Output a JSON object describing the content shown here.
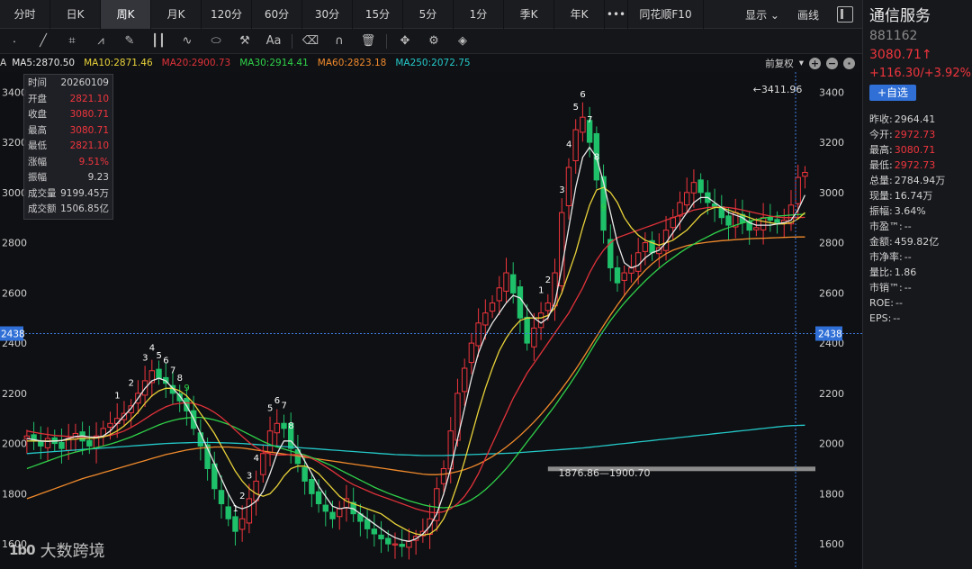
{
  "tabs": [
    {
      "label": "分时",
      "active": false
    },
    {
      "label": "日K",
      "active": false
    },
    {
      "label": "周K",
      "active": true
    },
    {
      "label": "月K",
      "active": false
    },
    {
      "label": "120分",
      "active": false
    },
    {
      "label": "60分",
      "active": false
    },
    {
      "label": "30分",
      "active": false
    },
    {
      "label": "15分",
      "active": false
    },
    {
      "label": "5分",
      "active": false
    },
    {
      "label": "1分",
      "active": false
    },
    {
      "label": "季K",
      "active": false
    },
    {
      "label": "年K",
      "active": false
    }
  ],
  "tab_more": "•••",
  "tab_f10": "同花顺F10",
  "tab_display": "显示",
  "tab_draw": "画线",
  "toolbar_icons": [
    "cursor-icon",
    "line-icon",
    "crop-icon",
    "fan-icon",
    "pencil-ruler-icon",
    "bars-icon",
    "wave-icon",
    "ellipse-icon",
    "hammer-icon",
    "text-icon",
    "eraser-icon",
    "magnet-icon",
    "trash-icon",
    "move-icon",
    "gear-icon",
    "layers-icon"
  ],
  "ma_bar": {
    "prefix": "A",
    "items": [
      {
        "label": "MA5:2870.50",
        "color": "#e8e8e8"
      },
      {
        "label": "MA10:2871.46",
        "color": "#e8d23a"
      },
      {
        "label": "MA20:2900.73",
        "color": "#e0323a"
      },
      {
        "label": "MA30:2914.41",
        "color": "#2fd24a"
      },
      {
        "label": "MA60:2823.18",
        "color": "#f08a2c"
      },
      {
        "label": "MA250:2072.75",
        "color": "#24c8c8"
      }
    ],
    "adjust": "前复权",
    "plus": "+",
    "minus": "−"
  },
  "info_panel": [
    {
      "k": "时间",
      "v": "20260109",
      "up": false
    },
    {
      "k": "开盘",
      "v": "2821.10",
      "up": true
    },
    {
      "k": "收盘",
      "v": "3080.71",
      "up": true
    },
    {
      "k": "最高",
      "v": "3080.71",
      "up": true
    },
    {
      "k": "最低",
      "v": "2821.10",
      "up": true
    },
    {
      "k": "涨幅",
      "v": "9.51%",
      "up": true
    },
    {
      "k": "振幅",
      "v": "9.23",
      "up": false
    },
    {
      "k": "成交量",
      "v": "9199.45万",
      "up": false
    },
    {
      "k": "成交额",
      "v": "1506.85亿",
      "up": false
    }
  ],
  "stock": {
    "name": "通信服务",
    "code": "881162",
    "price": "3080.71↑",
    "change": "+116.30/+3.92%",
    "watch": "+自选"
  },
  "quotes": [
    {
      "k": "昨收:",
      "v": "2964.41",
      "up": false
    },
    {
      "k": "今开:",
      "v": "2972.73",
      "up": true
    },
    {
      "k": "最高:",
      "v": "3080.71",
      "up": true
    },
    {
      "k": "最低:",
      "v": "2972.73",
      "up": true
    },
    {
      "k": "总量:",
      "v": "2784.94万",
      "up": false
    },
    {
      "k": "现量:",
      "v": "16.74万",
      "up": false
    },
    {
      "k": "振幅:",
      "v": "3.64%",
      "up": false
    },
    {
      "k": "市盈™:",
      "v": "--",
      "up": false
    },
    {
      "k": "金额:",
      "v": "459.82亿",
      "up": false
    },
    {
      "k": "市净率:",
      "v": "--",
      "up": false
    },
    {
      "k": "量比:",
      "v": "1.86",
      "up": false
    },
    {
      "k": "市销™:",
      "v": "--",
      "up": false
    },
    {
      "k": "ROE:",
      "v": "--",
      "up": false
    },
    {
      "k": "EPS:",
      "v": "--",
      "up": false
    }
  ],
  "watermark": {
    "logo": "1b0",
    "text": "大数跨境"
  },
  "chart_data": {
    "type": "candlestick",
    "ylim": [
      1500,
      3480
    ],
    "y_ticks": [
      1600,
      1800,
      2000,
      2200,
      2400,
      2600,
      2800,
      3000,
      3200,
      3400
    ],
    "crosshair_y": 2438,
    "crosshair_label": "2438",
    "annotations": [
      {
        "label": "3411.96",
        "value": 3411.96,
        "bar": 104
      },
      {
        "label": "1876.86—1900.70",
        "value": 1876.86,
        "bar": 76
      }
    ],
    "support_level": 1900.7,
    "ma_colors": {
      "ma5": "#e8e8e8",
      "ma10": "#e8d23a",
      "ma20": "#e0323a",
      "ma30": "#2fd24a",
      "ma60": "#f08a2c",
      "ma250": "#24c8c8"
    },
    "up_color": "#f0353d",
    "down_color": "#1fc06a",
    "td_marks": [
      {
        "bar": 13,
        "label": "1",
        "color": "#ffffff"
      },
      {
        "bar": 15,
        "label": "2",
        "color": "#ffffff"
      },
      {
        "bar": 17,
        "label": "3",
        "color": "#ffffff"
      },
      {
        "bar": 18,
        "label": "4",
        "color": "#ffffff"
      },
      {
        "bar": 19,
        "label": "5",
        "color": "#ffffff"
      },
      {
        "bar": 20,
        "label": "6",
        "color": "#ffffff"
      },
      {
        "bar": 21,
        "label": "7",
        "color": "#ffffff"
      },
      {
        "bar": 22,
        "label": "8",
        "color": "#ffffff"
      },
      {
        "bar": 23,
        "label": "9",
        "color": "#2fd24a"
      },
      {
        "bar": 30,
        "label": "1",
        "color": "#ffffff"
      },
      {
        "bar": 31,
        "label": "2",
        "color": "#ffffff"
      },
      {
        "bar": 32,
        "label": "3",
        "color": "#ffffff"
      },
      {
        "bar": 33,
        "label": "4",
        "color": "#ffffff"
      },
      {
        "bar": 35,
        "label": "5",
        "color": "#ffffff"
      },
      {
        "bar": 36,
        "label": "6",
        "color": "#ffffff"
      },
      {
        "bar": 37,
        "label": "7",
        "color": "#ffffff"
      },
      {
        "bar": 38,
        "label": "8",
        "color": "#ffffff"
      },
      {
        "bar": 74,
        "label": "1",
        "color": "#ffffff"
      },
      {
        "bar": 75,
        "label": "2",
        "color": "#ffffff"
      },
      {
        "bar": 77,
        "label": "3",
        "color": "#ffffff"
      },
      {
        "bar": 78,
        "label": "4",
        "color": "#ffffff"
      },
      {
        "bar": 79,
        "label": "5",
        "color": "#ffffff"
      },
      {
        "bar": 80,
        "label": "6",
        "color": "#ffffff"
      },
      {
        "bar": 81,
        "label": "7",
        "color": "#ffffff"
      },
      {
        "bar": 82,
        "label": "8",
        "color": "#ffffff"
      },
      {
        "bar": 83,
        "label": "9",
        "color": "#2fd24a"
      }
    ],
    "closes": [
      2030,
      2010,
      1990,
      2020,
      2000,
      1980,
      2020,
      2040,
      2010,
      1990,
      2030,
      2060,
      2080,
      2100,
      2120,
      2150,
      2200,
      2250,
      2290,
      2260,
      2240,
      2200,
      2170,
      2130,
      2060,
      1990,
      1900,
      1820,
      1760,
      1700,
      1650,
      1700,
      1780,
      1850,
      1960,
      2050,
      2080,
      2060,
      1980,
      1920,
      1850,
      1800,
      1760,
      1730,
      1700,
      1740,
      1780,
      1720,
      1690,
      1660,
      1640,
      1620,
      1600,
      1600,
      1590,
      1610,
      1630,
      1650,
      1700,
      1820,
      1900,
      2050,
      2200,
      2300,
      2400,
      2480,
      2520,
      2560,
      2620,
      2680,
      2600,
      2500,
      2400,
      2460,
      2520,
      2560,
      2680,
      2920,
      3100,
      3250,
      3300,
      3200,
      3050,
      2850,
      2700,
      2640,
      2680,
      2700,
      2760,
      2800,
      2760,
      2780,
      2850,
      2900,
      2960,
      3000,
      3040,
      3000,
      2960,
      2940,
      2900,
      2870,
      2920,
      2880,
      2850,
      2860,
      2900,
      2890,
      2880,
      2890,
      2950,
      3060,
      3080
    ],
    "ma5": [
      2020,
      2015,
      2010,
      2008,
      2010,
      2012,
      2020,
      2028,
      2030,
      2026,
      2024,
      2030,
      2050,
      2080,
      2110,
      2140,
      2180,
      2220,
      2250,
      2260,
      2250,
      2220,
      2190,
      2150,
      2100,
      2040,
      1980,
      1920,
      1860,
      1800,
      1750,
      1740,
      1750,
      1770,
      1810,
      1880,
      1960,
      2010,
      2010,
      1980,
      1930,
      1880,
      1830,
      1790,
      1750,
      1740,
      1745,
      1740,
      1720,
      1700,
      1680,
      1660,
      1640,
      1625,
      1615,
      1610,
      1620,
      1640,
      1670,
      1720,
      1800,
      1900,
      2020,
      2140,
      2260,
      2360,
      2430,
      2480,
      2520,
      2560,
      2590,
      2580,
      2540,
      2500,
      2480,
      2500,
      2560,
      2700,
      2860,
      3020,
      3140,
      3180,
      3140,
      3040,
      2920,
      2800,
      2720,
      2700,
      2710,
      2740,
      2760,
      2770,
      2800,
      2840,
      2880,
      2920,
      2960,
      2980,
      2980,
      2960,
      2940,
      2920,
      2910,
      2900,
      2880,
      2870,
      2870,
      2870,
      2875,
      2880,
      2890,
      2930,
      2990
    ],
    "ma10": [
      2010,
      2010,
      2010,
      2010,
      2010,
      2012,
      2015,
      2018,
      2020,
      2020,
      2022,
      2026,
      2036,
      2050,
      2070,
      2095,
      2125,
      2160,
      2190,
      2210,
      2220,
      2220,
      2210,
      2190,
      2160,
      2120,
      2080,
      2040,
      1990,
      1940,
      1890,
      1850,
      1820,
      1800,
      1790,
      1800,
      1830,
      1870,
      1900,
      1910,
      1910,
      1900,
      1880,
      1850,
      1820,
      1790,
      1770,
      1760,
      1750,
      1740,
      1730,
      1720,
      1700,
      1680,
      1665,
      1650,
      1640,
      1635,
      1640,
      1660,
      1700,
      1760,
      1840,
      1930,
      2030,
      2130,
      2220,
      2300,
      2370,
      2420,
      2460,
      2490,
      2500,
      2500,
      2500,
      2510,
      2540,
      2600,
      2680,
      2760,
      2860,
      2950,
      3010,
      3020,
      3000,
      2960,
      2900,
      2860,
      2830,
      2810,
      2800,
      2790,
      2800,
      2810,
      2830,
      2850,
      2880,
      2910,
      2930,
      2940,
      2940,
      2930,
      2920,
      2910,
      2900,
      2890,
      2885,
      2880,
      2875,
      2875,
      2880,
      2895,
      2920
    ],
    "ma20": [
      2050,
      2045,
      2040,
      2036,
      2032,
      2030,
      2028,
      2026,
      2026,
      2026,
      2026,
      2028,
      2032,
      2040,
      2050,
      2064,
      2080,
      2098,
      2116,
      2132,
      2146,
      2156,
      2160,
      2162,
      2160,
      2152,
      2140,
      2124,
      2104,
      2080,
      2054,
      2028,
      2004,
      1984,
      1968,
      1958,
      1954,
      1954,
      1956,
      1956,
      1950,
      1940,
      1926,
      1908,
      1890,
      1870,
      1852,
      1836,
      1824,
      1812,
      1800,
      1790,
      1780,
      1770,
      1760,
      1750,
      1740,
      1732,
      1726,
      1724,
      1728,
      1740,
      1760,
      1790,
      1830,
      1880,
      1940,
      2000,
      2060,
      2120,
      2180,
      2230,
      2280,
      2320,
      2360,
      2400,
      2440,
      2480,
      2520,
      2570,
      2620,
      2680,
      2730,
      2770,
      2800,
      2820,
      2830,
      2840,
      2850,
      2860,
      2870,
      2880,
      2890,
      2900,
      2910,
      2920,
      2930,
      2935,
      2940,
      2942,
      2942,
      2940,
      2936,
      2930,
      2924,
      2918,
      2912,
      2906,
      2902,
      2900,
      2900,
      2900,
      2901
    ],
    "ma30": [
      1900,
      1910,
      1920,
      1930,
      1940,
      1950,
      1958,
      1966,
      1972,
      1978,
      1984,
      1990,
      1998,
      2006,
      2016,
      2026,
      2038,
      2050,
      2062,
      2074,
      2084,
      2092,
      2098,
      2102,
      2104,
      2104,
      2100,
      2094,
      2086,
      2076,
      2064,
      2050,
      2036,
      2022,
      2008,
      1996,
      1986,
      1978,
      1970,
      1962,
      1954,
      1944,
      1934,
      1922,
      1910,
      1896,
      1882,
      1868,
      1854,
      1840,
      1826,
      1814,
      1802,
      1792,
      1782,
      1772,
      1764,
      1756,
      1750,
      1746,
      1744,
      1746,
      1752,
      1762,
      1776,
      1794,
      1816,
      1842,
      1870,
      1900,
      1934,
      1970,
      2006,
      2042,
      2078,
      2114,
      2150,
      2190,
      2230,
      2272,
      2316,
      2362,
      2408,
      2450,
      2490,
      2526,
      2560,
      2590,
      2620,
      2648,
      2674,
      2698,
      2720,
      2740,
      2760,
      2778,
      2794,
      2810,
      2824,
      2838,
      2850,
      2860,
      2870,
      2878,
      2886,
      2892,
      2898,
      2902,
      2906,
      2908,
      2910,
      2912,
      2914
    ],
    "ma60": [
      1780,
      1790,
      1800,
      1810,
      1820,
      1830,
      1840,
      1850,
      1860,
      1868,
      1876,
      1884,
      1892,
      1900,
      1908,
      1916,
      1924,
      1932,
      1940,
      1948,
      1956,
      1962,
      1968,
      1974,
      1978,
      1982,
      1984,
      1986,
      1986,
      1986,
      1984,
      1982,
      1978,
      1974,
      1970,
      1966,
      1962,
      1958,
      1954,
      1950,
      1946,
      1942,
      1938,
      1934,
      1930,
      1926,
      1922,
      1918,
      1914,
      1910,
      1906,
      1902,
      1898,
      1894,
      1890,
      1886,
      1882,
      1878,
      1876,
      1876,
      1878,
      1882,
      1888,
      1896,
      1906,
      1918,
      1932,
      1948,
      1966,
      1986,
      2008,
      2032,
      2058,
      2086,
      2116,
      2148,
      2182,
      2218,
      2256,
      2296,
      2338,
      2382,
      2426,
      2470,
      2512,
      2552,
      2590,
      2626,
      2660,
      2690,
      2716,
      2738,
      2756,
      2770,
      2780,
      2788,
      2794,
      2798,
      2802,
      2805,
      2808,
      2810,
      2812,
      2814,
      2816,
      2817,
      2818,
      2819,
      2820,
      2821,
      2822,
      2823,
      2823
    ],
    "ma250": [
      1960,
      1962,
      1964,
      1966,
      1968,
      1970,
      1972,
      1974,
      1976,
      1978,
      1980,
      1982,
      1984,
      1986,
      1988,
      1990,
      1992,
      1994,
      1996,
      1998,
      2000,
      2001,
      2002,
      2003,
      2004,
      2004,
      2004,
      2004,
      2003,
      2002,
      2001,
      2000,
      1998,
      1996,
      1994,
      1992,
      1990,
      1988,
      1986,
      1984,
      1982,
      1980,
      1978,
      1976,
      1974,
      1972,
      1970,
      1968,
      1966,
      1964,
      1962,
      1960,
      1958,
      1956,
      1955,
      1954,
      1953,
      1952,
      1952,
      1952,
      1952,
      1953,
      1954,
      1955,
      1956,
      1957,
      1958,
      1959,
      1960,
      1961,
      1962,
      1964,
      1966,
      1968,
      1970,
      1972,
      1974,
      1976,
      1978,
      1980,
      1982,
      1985,
      1988,
      1991,
      1994,
      1997,
      2000,
      2003,
      2006,
      2009,
      2012,
      2015,
      2018,
      2021,
      2024,
      2027,
      2030,
      2033,
      2036,
      2039,
      2042,
      2045,
      2048,
      2051,
      2054,
      2057,
      2060,
      2063,
      2066,
      2069,
      2071,
      2072,
      2073
    ]
  }
}
